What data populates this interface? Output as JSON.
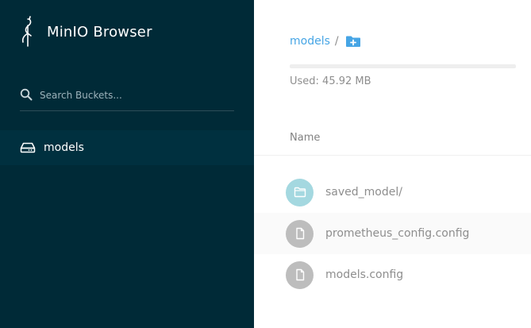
{
  "app": {
    "title": "MinIO Browser"
  },
  "sidebar": {
    "search": {
      "placeholder": "Search Buckets...",
      "value": ""
    },
    "buckets": [
      {
        "label": "models",
        "active": true
      }
    ]
  },
  "main": {
    "breadcrumb": {
      "bucket": "models",
      "separator": "/"
    },
    "usage": {
      "text": "Used: 45.92 MB"
    },
    "table": {
      "column_header": "Name",
      "rows": [
        {
          "name": "saved_model/",
          "type": "folder",
          "icon": "folder-icon"
        },
        {
          "name": "prometheus_config.config",
          "type": "file",
          "icon": "file-icon"
        },
        {
          "name": "models.config",
          "type": "file",
          "icon": "file-icon"
        }
      ]
    }
  },
  "colors": {
    "sidebar_bg": "#002a37",
    "active_item_bg": "#00303f",
    "accent": "#46a5e5",
    "folder_icon_bg": "#a4d8e0",
    "file_icon_bg": "#bdbdbd",
    "text_muted": "#8e8e8e"
  }
}
